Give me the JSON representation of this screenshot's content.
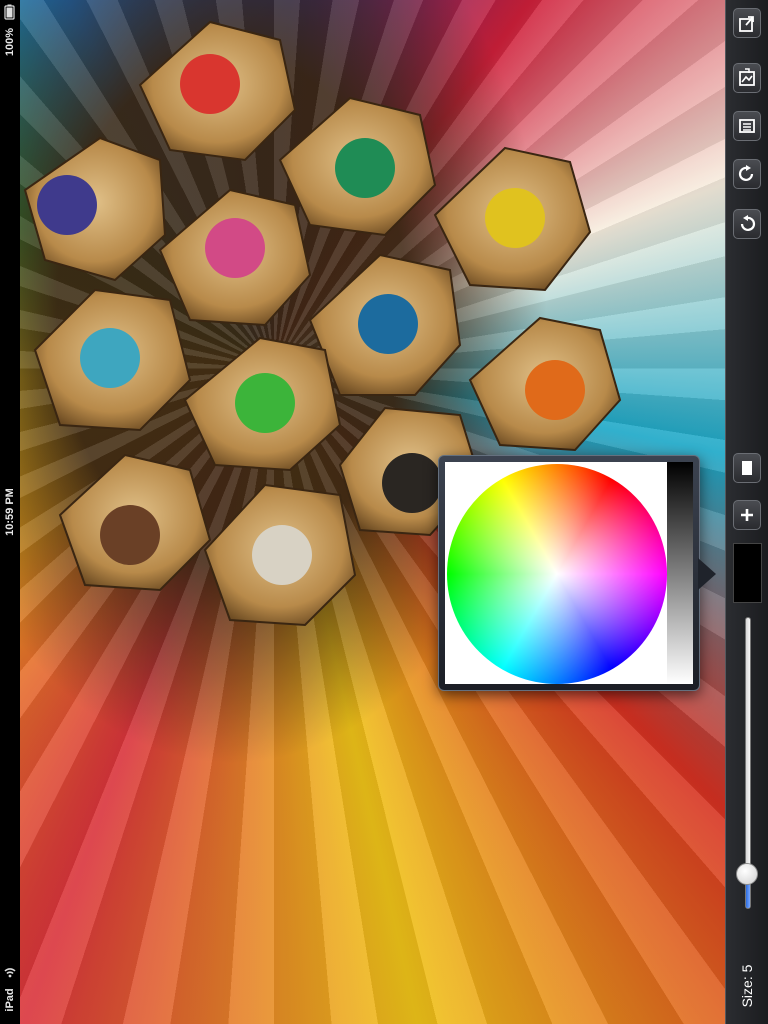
{
  "status_bar": {
    "battery": "100%",
    "time": "10:59 PM",
    "device": "iPad"
  },
  "toolbar": {
    "buttons": [
      {
        "name": "share-export",
        "icon": "export-icon"
      },
      {
        "name": "save-photo",
        "icon": "save-image-icon"
      },
      {
        "name": "layers",
        "icon": "layers-icon"
      },
      {
        "name": "redo",
        "icon": "redo-icon"
      },
      {
        "name": "undo",
        "icon": "undo-icon"
      },
      {
        "name": "eraser",
        "icon": "eraser-icon"
      },
      {
        "name": "add",
        "icon": "plus-icon"
      }
    ],
    "selected_color": "#000000",
    "brush_size_label": "Size: 5",
    "brush_size_fraction": 0.1
  },
  "popover": {
    "wheel": "hsv-color-wheel",
    "brightness": "black-to-white"
  }
}
